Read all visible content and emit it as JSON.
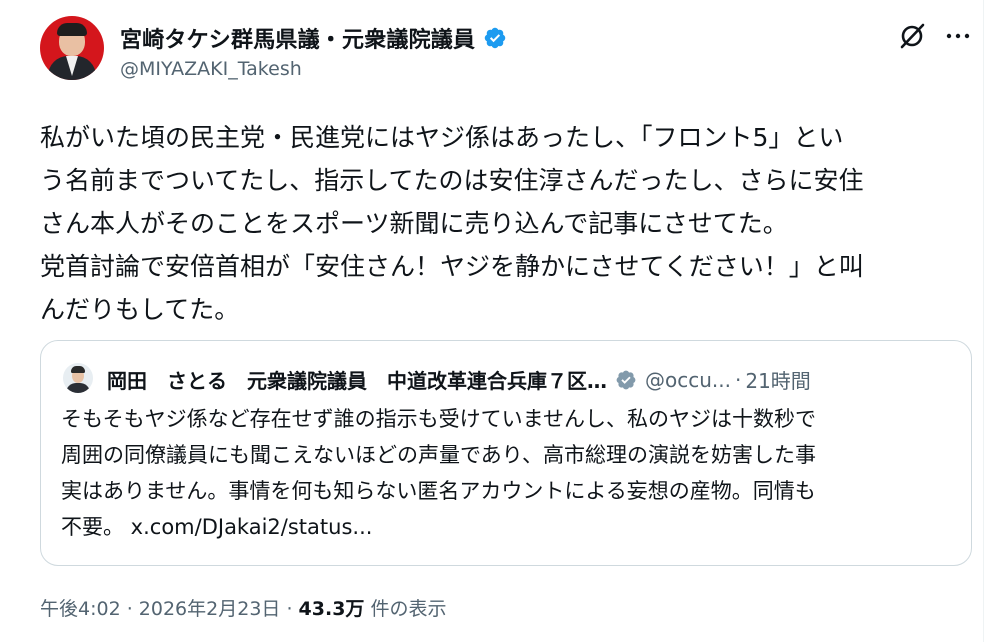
{
  "author": {
    "name": "宮崎タケシ群馬県議・元衆議院議員",
    "handle": "@MIYAZAKI_Takesh"
  },
  "tweet_text": "私がいた頃の民主党・民進党にはヤジ係はあったし、「フロント5」とい\nう名前までついてたし、指示してたのは安住淳さんだったし、さらに安住\nさん本人がそのことをスポーツ新聞に売り込んで記事にさせてた。\n党首討論で安倍首相が「安住さん！ヤジを静かにさせてください！」と叫\nんだりもしてた。",
  "quote": {
    "name": "岡田　さとる　元衆議院議員　中道改革連合兵庫７区…",
    "handle": "@occu...",
    "separator": "·",
    "time": "21時間",
    "text": "そもそもヤジ係など存在せず誰の指示も受けていませんし、私のヤジは十数秒で\n周囲の同僚議員にも聞こえないほどの声量であり、高市総理の演説を妨害した事\n実はありません。事情を何も知らない匿名アカウントによる妄想の産物。同情も\n不要。 x.com/DJakai2/status..."
  },
  "meta": {
    "timestamp": "午後4:02 · 2026年2月23日 · ",
    "views": "43.3万",
    "views_label": " 件の表示"
  },
  "icons": {
    "verified": "verified-badge-icon",
    "grok": "grok-icon",
    "more": "more-icon"
  },
  "colors": {
    "verified_blue": "#1d9bf0",
    "secondary_text": "#536471",
    "border": "#cfd9de"
  }
}
